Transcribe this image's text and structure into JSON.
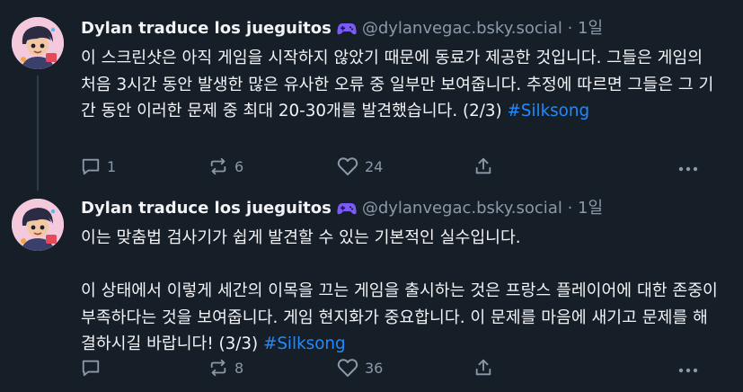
{
  "posts": [
    {
      "author": "Dylan traduce los jueguitos",
      "handle": "@dylanvegac.bsky.social",
      "separator": "·",
      "time": "1일",
      "badge_icon": "gamepad-icon",
      "text_before_tag": "이 스크린샷은 아직 게임을 시작하지 않았기 때문에 동료가 제공한 것입니다. 그들은 게임의 처음 3시간 동안 발생한 많은 유사한 오류 중 일부만 보여줍니다. 추정에 따르면 그들은 그 기간 동안 이러한 문제 중 최대 20-30개를 발견했습니다. (2/3) ",
      "hashtag": "#Silksong",
      "text_after_tag": "",
      "counts": {
        "replies": "1",
        "reposts": "6",
        "likes": "24"
      }
    },
    {
      "author": "Dylan traduce los jueguitos",
      "handle": "@dylanvegac.bsky.social",
      "separator": "·",
      "time": "1일",
      "badge_icon": "gamepad-icon",
      "text_before_tag": "이는 맞춤법 검사기가 쉽게 발견할 수 있는 기본적인 실수입니다.\n\n이 상태에서 이렇게 세간의 이목을 끄는 게임을 출시하는 것은 프랑스 플레이어에 대한 존중이 부족하다는 것을 보여줍니다. 게임 현지화가 중요합니다. 이 문제를 마음에 새기고 문제를 해결하시길 바랍니다! (3/3) ",
      "hashtag": "#Silksong",
      "text_after_tag": "",
      "counts": {
        "replies": "",
        "reposts": "8",
        "likes": "36"
      }
    }
  ],
  "colors": {
    "background": "#161e27",
    "text": "#f1f3f5",
    "muted": "#8a99aa",
    "link": "#208bfe",
    "gamepad": "#7a5af8",
    "thread_line": "#2e3d4e"
  }
}
